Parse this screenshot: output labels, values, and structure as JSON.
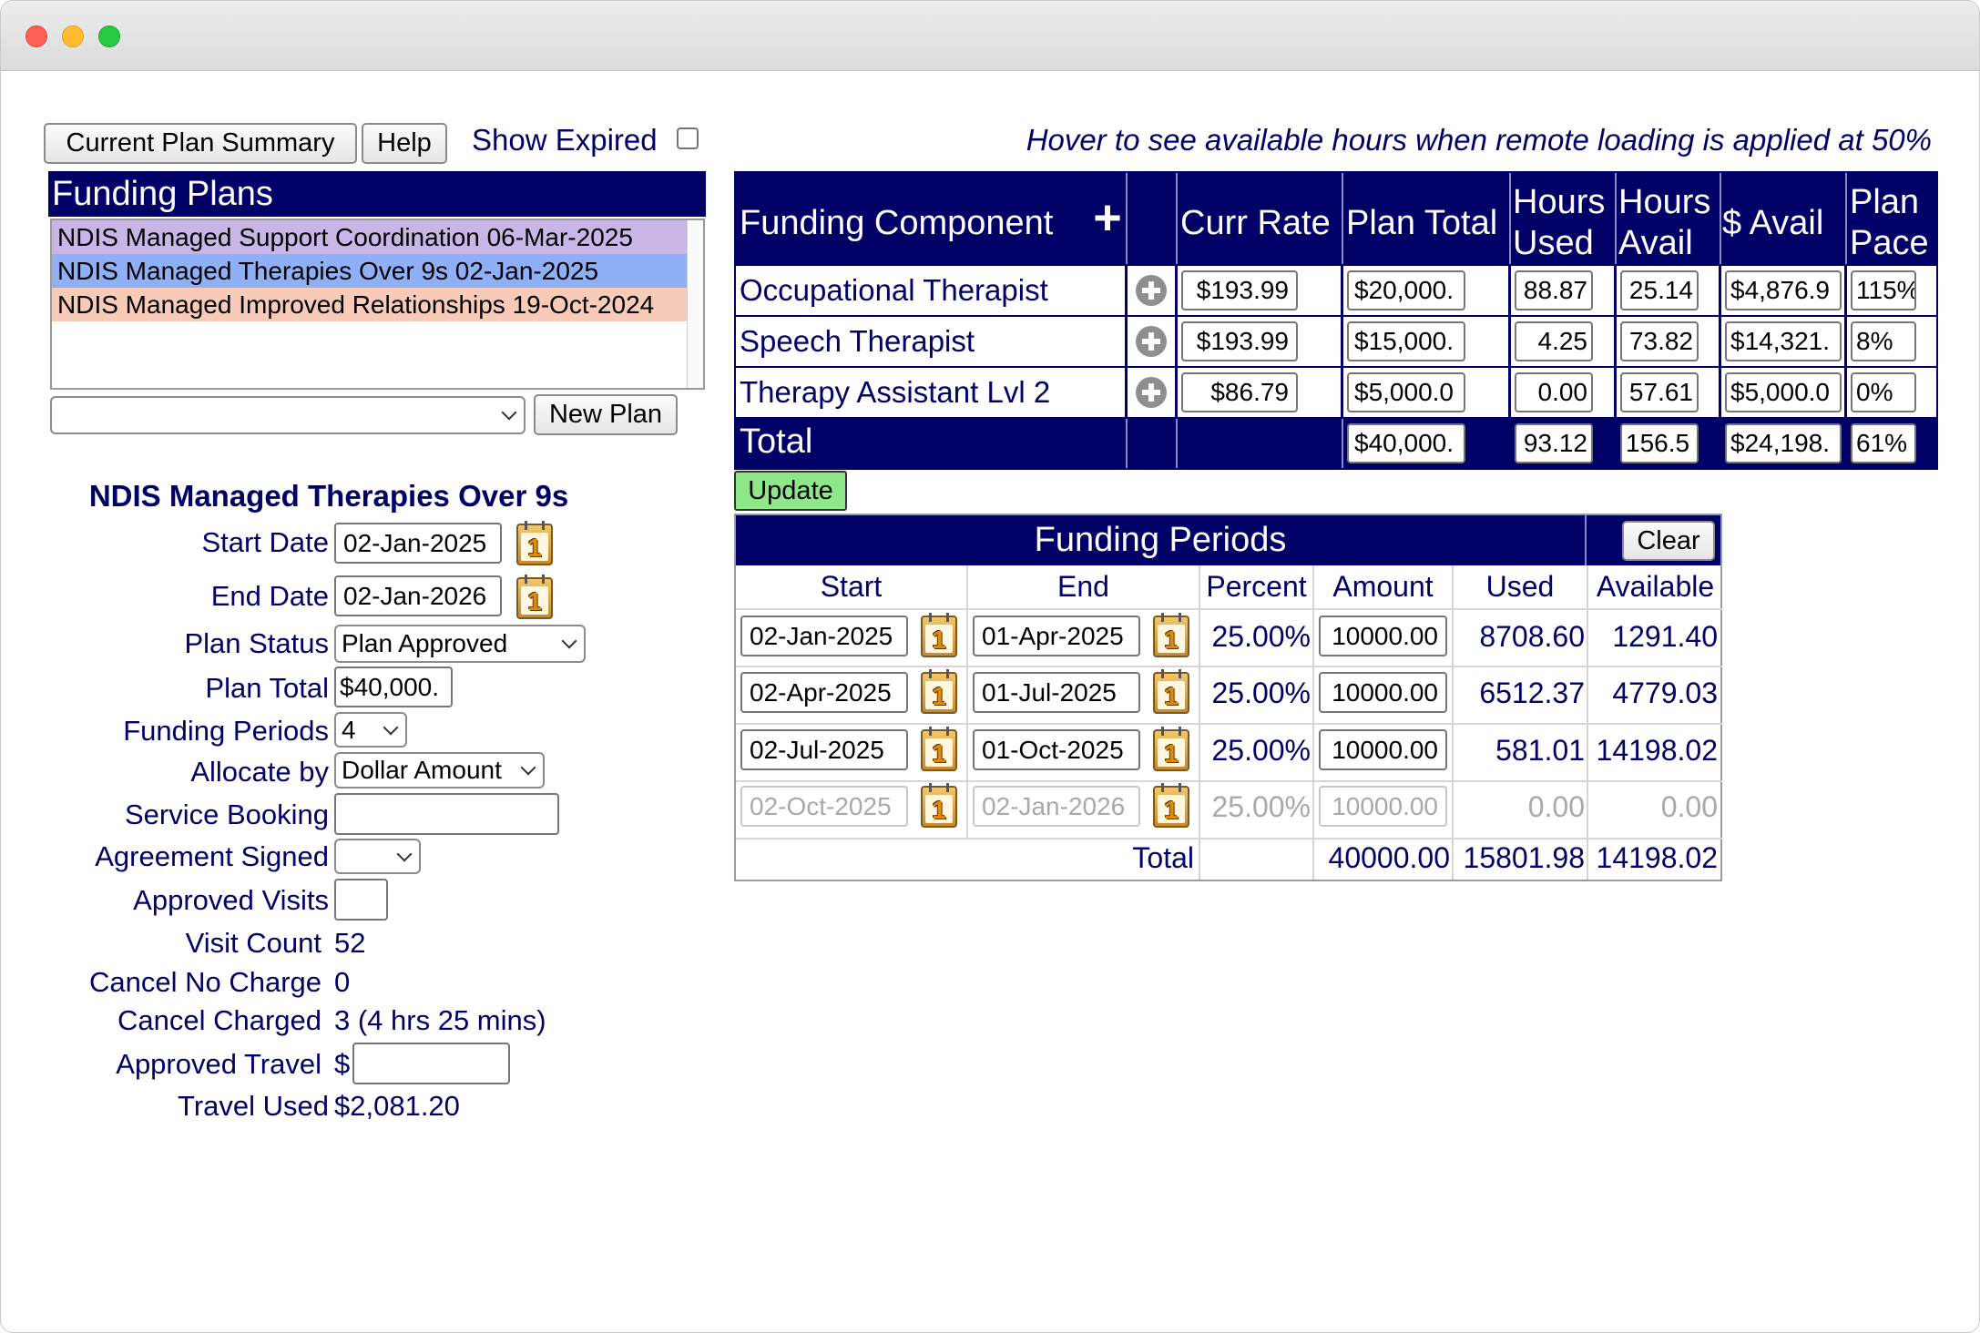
{
  "toolbar": {
    "current_plan_summary": "Current Plan Summary",
    "help": "Help",
    "show_expired": "Show Expired",
    "hover_note": "Hover to see available hours when remote loading is applied at 50%"
  },
  "funding_plans": {
    "title": "Funding Plans",
    "items": [
      {
        "label": "NDIS Managed Support Coordination 06-Mar-2025",
        "color": "#c8b6e6"
      },
      {
        "label": "NDIS Managed Therapies Over 9s 02-Jan-2025",
        "color": "#8fb0f7"
      },
      {
        "label": "NDIS Managed Improved Relationships 19-Oct-2024",
        "color": "#f7cbb8"
      }
    ],
    "new_plan": "New Plan",
    "plan_select_value": ""
  },
  "plan_detail": {
    "title": "NDIS Managed Therapies Over 9s",
    "start_date_label": "Start Date",
    "start_date": "02-Jan-2025",
    "end_date_label": "End Date",
    "end_date": "02-Jan-2026",
    "plan_status_label": "Plan Status",
    "plan_status": "Plan Approved",
    "plan_total_label": "Plan Total",
    "plan_total": "$40,000.",
    "funding_periods_label": "Funding Periods",
    "funding_periods": "4",
    "allocate_by_label": "Allocate by",
    "allocate_by": "Dollar Amount",
    "service_booking_label": "Service Booking",
    "service_booking": "",
    "agreement_signed_label": "Agreement Signed",
    "agreement_signed": "",
    "approved_visits_label": "Approved Visits",
    "approved_visits": "",
    "visit_count_label": "Visit Count",
    "visit_count": "52",
    "cancel_no_charge_label": "Cancel No Charge",
    "cancel_no_charge": "0",
    "cancel_charged_label": "Cancel Charged",
    "cancel_charged": "3 (4 hrs 25 mins)",
    "approved_travel_label": "Approved Travel",
    "approved_travel_prefix": "$",
    "approved_travel": "",
    "travel_used_label": "Travel Used",
    "travel_used": "$2,081.20"
  },
  "components": {
    "headers": {
      "component": "Funding Component",
      "add": "+",
      "curr_rate": "Curr Rate",
      "plan_total": "Plan Total",
      "hours_used_1": "Hours",
      "hours_used_2": "Used",
      "hours_avail_1": "Hours",
      "hours_avail_2": "Avail",
      "dollar_avail": "$ Avail",
      "plan_pace_1": "Plan",
      "plan_pace_2": "Pace"
    },
    "rows": [
      {
        "name": "Occupational Therapist",
        "rate": "$193.99",
        "total": "$20,000.",
        "hours_used": "88.87",
        "hours_avail": "25.14",
        "avail": "$4,876.9",
        "pace": "115%"
      },
      {
        "name": "Speech Therapist",
        "rate": "$193.99",
        "total": "$15,000.",
        "hours_used": "4.25",
        "hours_avail": "73.82",
        "avail": "$14,321.",
        "pace": "8%"
      },
      {
        "name": "Therapy Assistant Lvl 2",
        "rate": "$86.79",
        "total": "$5,000.0",
        "hours_used": "0.00",
        "hours_avail": "57.61",
        "avail": "$5,000.0",
        "pace": "0%"
      }
    ],
    "total": {
      "label": "Total",
      "total": "$40,000.",
      "hours_used": "93.12",
      "hours_avail": "156.5",
      "avail": "$24,198.",
      "pace": "61%"
    },
    "update": "Update"
  },
  "periods": {
    "title": "Funding Periods",
    "clear": "Clear",
    "headers": {
      "start": "Start",
      "end": "End",
      "percent": "Percent",
      "amount": "Amount",
      "used": "Used",
      "available": "Available"
    },
    "rows": [
      {
        "start": "02-Jan-2025",
        "end": "01-Apr-2025",
        "percent": "25.00%",
        "amount": "10000.00",
        "used": "8708.60",
        "available": "1291.40"
      },
      {
        "start": "02-Apr-2025",
        "end": "01-Jul-2025",
        "percent": "25.00%",
        "amount": "10000.00",
        "used": "6512.37",
        "available": "4779.03"
      },
      {
        "start": "02-Jul-2025",
        "end": "01-Oct-2025",
        "percent": "25.00%",
        "amount": "10000.00",
        "used": "581.01",
        "available": "14198.02"
      },
      {
        "start": "02-Oct-2025",
        "end": "02-Jan-2026",
        "percent": "25.00%",
        "amount": "10000.00",
        "used": "0.00",
        "available": "0.00"
      }
    ],
    "total": {
      "label": "Total",
      "amount": "40000.00",
      "used": "15801.98",
      "available": "14198.02"
    }
  }
}
